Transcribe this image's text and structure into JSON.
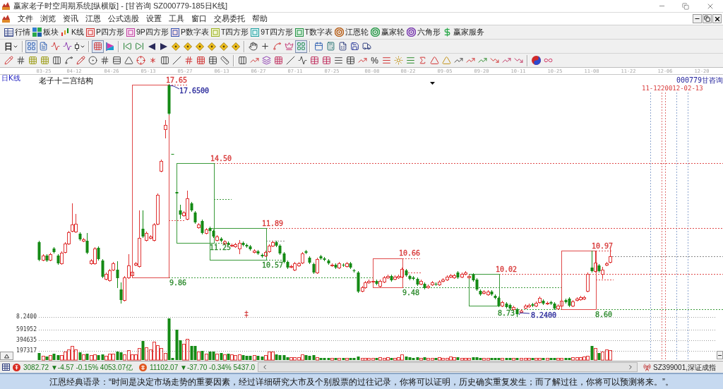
{
  "window": {
    "title": "赢家老子时空周期系统[纵横版] - [甘咨询 SZ000779-185日K线]"
  },
  "menu": [
    "文件",
    "浏览",
    "资讯",
    "江恩",
    "公式选股",
    "设置",
    "工具",
    "窗口",
    "交易委托",
    "帮助"
  ],
  "toolbar_1": [
    "行情",
    "板块",
    "K线",
    "P四方形",
    "9P四方形",
    "P数字表",
    "T四方形",
    "9T四方形",
    "T数字表",
    "江恩轮",
    "赢家轮",
    "六角形",
    "赢家服务"
  ],
  "toolbar_2": {
    "period": "日",
    "buttons": [
      {
        "pressed": true
      },
      {
        "pressed": false
      },
      {
        "pressed": false
      },
      {
        "pressed": false
      },
      {
        "pressed": false
      },
      {
        "pressed": true
      },
      {
        "pressed": false
      },
      {
        "pressed": false
      },
      {
        "pressed": false
      },
      {
        "pressed": false
      },
      {
        "pressed": false
      },
      {
        "pressed": false
      },
      {
        "pressed": false
      },
      {
        "pressed": false
      },
      {
        "pressed": false
      },
      {
        "pressed": false
      },
      {
        "pressed": false
      },
      {
        "pressed": false
      },
      {
        "pressed": false
      },
      {
        "pressed": false
      },
      {
        "pressed": false
      },
      {
        "pressed": true
      },
      {
        "pressed": false
      },
      {
        "pressed": false
      },
      {
        "pressed": false
      },
      {
        "pressed": false
      },
      {
        "pressed": false
      }
    ]
  },
  "toolbar_3": {
    "percent_button": "%"
  },
  "chart": {
    "period_label": "日K线",
    "title": "老子十二宫结构",
    "stock_code": "000779",
    "stock_name": "甘咨询",
    "dates": [
      "03-25",
      "04-12",
      "04-26",
      "05-13",
      "05-27",
      "06-13",
      "06-27",
      "07-11",
      "07-25",
      "08-08",
      "08-22",
      "09-05",
      "09-20",
      "10-11",
      "10-25",
      "11-08",
      "11-22",
      "12-06",
      "12-20"
    ],
    "cycle_dates": "11-1220012-02-13",
    "annotations": [
      {
        "text": "17.65",
        "color": "#d83a3a"
      },
      {
        "text": "17.6500",
        "color": "#2b2b9c"
      },
      {
        "text": "14.50",
        "color": "#d83a3a"
      },
      {
        "text": "11.89",
        "color": "#d83a3a"
      },
      {
        "text": "11.25",
        "color": "#2e8b2e"
      },
      {
        "text": "10.57",
        "color": "#2e8b2e"
      },
      {
        "text": "9.86",
        "color": "#2e8b2e"
      },
      {
        "text": "10.66",
        "color": "#d83a3a"
      },
      {
        "text": "9.48",
        "color": "#2e8b2e"
      },
      {
        "text": "10.02",
        "color": "#d83a3a"
      },
      {
        "text": "8.73",
        "color": "#2e8b2e"
      },
      {
        "text": "8.2400",
        "color": "#2b2b9c"
      },
      {
        "text": "10.97",
        "color": "#d83a3a"
      },
      {
        "text": "8.60",
        "color": "#2e8b2e"
      }
    ]
  },
  "volume": {
    "axis_labels": [
      "8.2400",
      "591952",
      "394635",
      "197317"
    ]
  },
  "status_bar": {
    "indexes": [
      "3082.72 ▼-4.57 -0.15% 4053.07亿",
      "11102.07 ▼-37.70 -0.34% 5437.0"
    ],
    "current_index": "SZ399001,深证成指"
  },
  "quote_banner": "江恩经典语录：“时间是决定市场走势的重要因素，经过详细研究大市及个别股票的过往记录，你将可以证明，历史确实重复发生；而了解过往，你将可以预测将来。”。"
}
